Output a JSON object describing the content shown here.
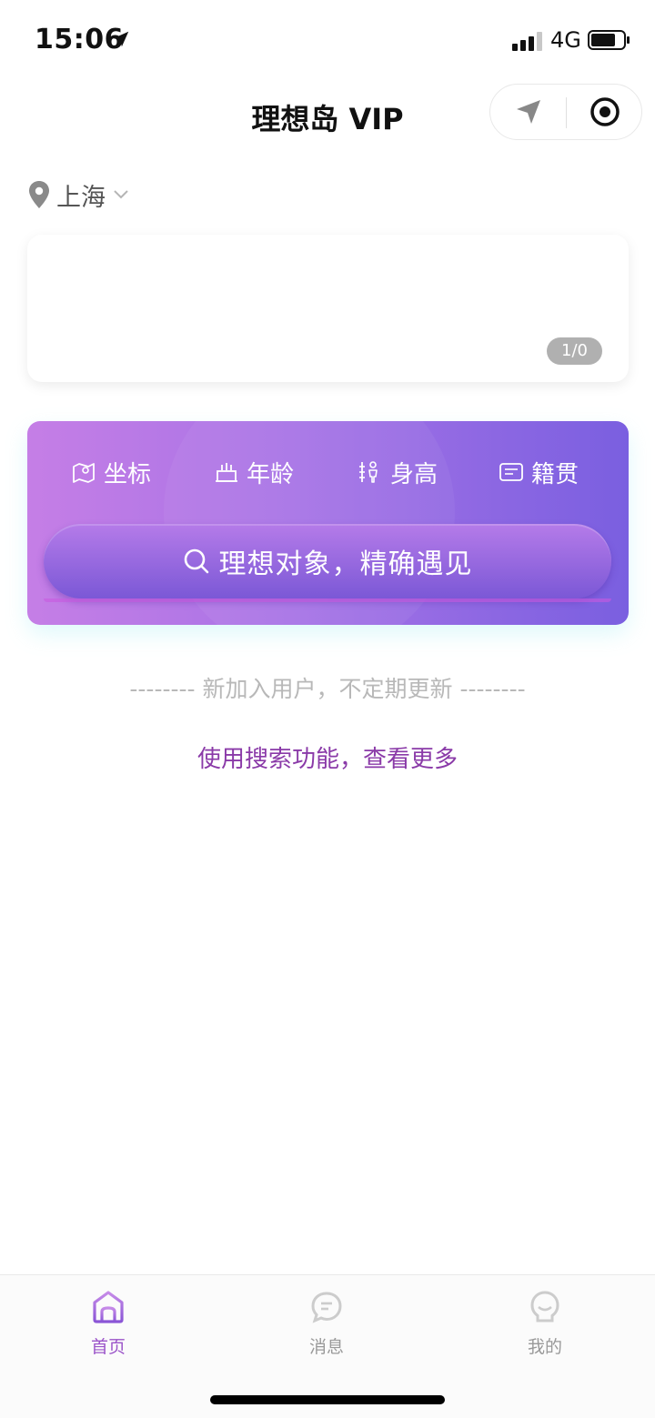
{
  "status_bar": {
    "time": "15:06",
    "network": "4G"
  },
  "header": {
    "title": "理想岛 VIP"
  },
  "city": {
    "name": "上海"
  },
  "banner": {
    "counter": "1/0"
  },
  "filters": [
    {
      "label": "坐标",
      "icon": "map-location-icon"
    },
    {
      "label": "年龄",
      "icon": "birthday-cake-icon"
    },
    {
      "label": "身高",
      "icon": "height-icon"
    },
    {
      "label": "籍贯",
      "icon": "id-card-icon"
    }
  ],
  "search": {
    "button_label": "理想对象，精确遇见"
  },
  "notice": {
    "new_users": "-------- 新加入用户，不定期更新 --------",
    "more_link": "使用搜索功能，查看更多"
  },
  "tabs": [
    {
      "label": "首页",
      "icon": "home-icon",
      "active": true
    },
    {
      "label": "消息",
      "icon": "message-icon",
      "active": false
    },
    {
      "label": "我的",
      "icon": "profile-icon",
      "active": false
    }
  ],
  "colors": {
    "accent": "#9b54c9",
    "gradient_start": "#c57ee6",
    "gradient_end": "#7a5fe0",
    "link": "#8a3aa8"
  }
}
